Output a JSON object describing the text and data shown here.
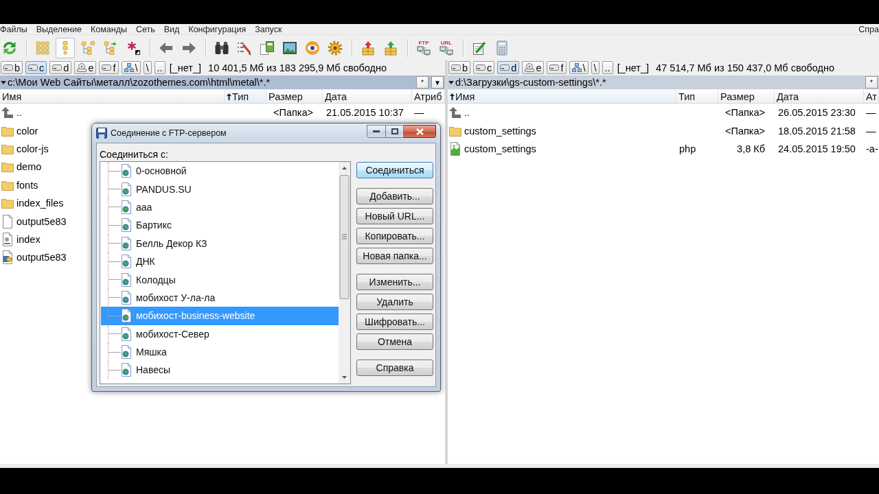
{
  "menu": {
    "items": [
      "Файлы",
      "Выделение",
      "Команды",
      "Сеть",
      "Вид",
      "Конфигурация",
      "Запуск"
    ],
    "help_item": "Спра"
  },
  "toolbar": [
    {
      "kind": "button",
      "selected": false
    },
    {
      "kind": "separator"
    },
    {
      "kind": "button",
      "selected": false
    },
    {
      "kind": "button",
      "selected": true
    },
    {
      "kind": "button",
      "selected": false
    },
    {
      "kind": "button",
      "selected": false
    },
    {
      "kind": "button",
      "selected": false
    },
    {
      "kind": "separator"
    },
    {
      "kind": "button",
      "selected": false
    },
    {
      "kind": "button",
      "selected": false
    },
    {
      "kind": "separator"
    },
    {
      "kind": "button",
      "selected": false
    },
    {
      "kind": "button",
      "selected": false
    },
    {
      "kind": "button",
      "selected": false
    },
    {
      "kind": "button",
      "selected": false
    },
    {
      "kind": "button",
      "selected": false
    },
    {
      "kind": "button",
      "selected": false
    },
    {
      "kind": "separator"
    },
    {
      "kind": "button",
      "selected": false
    },
    {
      "kind": "button",
      "selected": false
    },
    {
      "kind": "separator"
    },
    {
      "kind": "button",
      "selected": false,
      "label": "FTP"
    },
    {
      "kind": "button",
      "selected": false,
      "label": "URL"
    },
    {
      "kind": "separator"
    },
    {
      "kind": "button",
      "selected": false
    },
    {
      "kind": "button",
      "selected": false
    }
  ],
  "panels": [
    {
      "active": true,
      "drives": [
        {
          "label": "b",
          "kind": "disk",
          "selected": false
        },
        {
          "label": "c",
          "kind": "disk",
          "selected": true
        },
        {
          "label": "d",
          "kind": "disk",
          "selected": false
        },
        {
          "label": "e",
          "kind": "optical",
          "selected": false
        },
        {
          "label": "f",
          "kind": "disk",
          "selected": false
        }
      ],
      "nav_buttons": [
        {
          "kind": "network",
          "label": "\\"
        },
        {
          "kind": "plain",
          "label": "\\"
        },
        {
          "kind": "plain",
          "label": ".."
        }
      ],
      "volume_label": "[_нет_]",
      "free_space": "10 401,5 Мб из 183 295,9 Мб свободно",
      "path": "c:\\Мои Web Сайты\\металл\\zozothemes.com\\html\\metal\\*.*",
      "path_buttons": [
        "*",
        "▼"
      ],
      "columns": [
        {
          "label": "Имя",
          "sorted": false
        },
        {
          "label": "Тип",
          "sorted": true
        },
        {
          "label": "Размер",
          "sorted": false
        },
        {
          "label": "Дата",
          "sorted": false
        },
        {
          "label": "Атриб",
          "sorted": false
        }
      ],
      "rows": [
        {
          "kind": "parent",
          "name": "..",
          "size": "<Папка>",
          "date": "21.05.2015 10:37",
          "attributes": "—"
        },
        {
          "kind": "folder",
          "name": "color"
        },
        {
          "kind": "folder",
          "name": "color-js"
        },
        {
          "kind": "folder",
          "name": "demo"
        },
        {
          "kind": "folder",
          "name": "fonts"
        },
        {
          "kind": "folder",
          "name": "index_files"
        },
        {
          "kind": "file",
          "name": "output5e83"
        },
        {
          "kind": "html",
          "name": "index"
        },
        {
          "kind": "script",
          "name": "output5e83"
        }
      ]
    },
    {
      "active": false,
      "drives": [
        {
          "label": "b",
          "kind": "disk",
          "selected": false
        },
        {
          "label": "c",
          "kind": "disk",
          "selected": false
        },
        {
          "label": "d",
          "kind": "disk",
          "selected": true
        },
        {
          "label": "e",
          "kind": "optical",
          "selected": false
        },
        {
          "label": "f",
          "kind": "disk",
          "selected": false
        }
      ],
      "nav_buttons": [
        {
          "kind": "network",
          "label": "\\"
        },
        {
          "kind": "plain",
          "label": "\\"
        },
        {
          "kind": "plain",
          "label": ".."
        }
      ],
      "volume_label": "[_нет_]",
      "free_space": "47 514,7 Мб из 150 437,0 Мб свободно",
      "path": "d:\\Загрузки\\gs-custom-settings\\*.*",
      "path_buttons": [
        "*"
      ],
      "columns": [
        {
          "label": "Имя",
          "sorted": true
        },
        {
          "label": "Тип",
          "sorted": false
        },
        {
          "label": "Размер",
          "sorted": false
        },
        {
          "label": "Дата",
          "sorted": false
        },
        {
          "label": "Ат",
          "sorted": false
        }
      ],
      "rows": [
        {
          "kind": "parent",
          "name": "..",
          "size": "<Папка>",
          "date": "26.05.2015 23:30",
          "attributes": "—"
        },
        {
          "kind": "folder",
          "name": "custom_settings",
          "size": "<Папка>",
          "date": "18.05.2015 21:58",
          "attributes": "—"
        },
        {
          "kind": "php",
          "name": "custom_settings",
          "type": "php",
          "size": "3,8 Кб",
          "date": "24.05.2015 19:50",
          "attributes": "-a-"
        }
      ]
    }
  ],
  "dialog": {
    "title": "Соединение с FTP-сервером",
    "list_label": "Соединиться с:",
    "connections": [
      {
        "name": "0-основной",
        "selected": false
      },
      {
        "name": "PANDUS.SU",
        "selected": false
      },
      {
        "name": "aaa",
        "selected": false
      },
      {
        "name": "Бартикс",
        "selected": false
      },
      {
        "name": "Белль Декор КЗ",
        "selected": false
      },
      {
        "name": "ДНК",
        "selected": false
      },
      {
        "name": "Колодцы",
        "selected": false
      },
      {
        "name": "мобихост У-ла-ла",
        "selected": false
      },
      {
        "name": "мобихост-business-website",
        "selected": true
      },
      {
        "name": "мобихост-Север",
        "selected": false
      },
      {
        "name": "Мяшка",
        "selected": false
      },
      {
        "name": "Навесы",
        "selected": false
      }
    ],
    "button_groups": [
      [
        {
          "label": "Соединиться",
          "highlighted": true
        }
      ],
      [
        {
          "label": "Добавить...",
          "highlighted": false
        },
        {
          "label": "Новый URL...",
          "highlighted": false
        },
        {
          "label": "Копировать...",
          "highlighted": false
        },
        {
          "label": "Новая папка...",
          "highlighted": false
        }
      ],
      [
        {
          "label": "Изменить...",
          "highlighted": false
        },
        {
          "label": "Удалить",
          "highlighted": false
        },
        {
          "label": "Шифровать...",
          "highlighted": false
        },
        {
          "label": "Отмена",
          "highlighted": false
        }
      ],
      [
        {
          "label": "Справка",
          "highlighted": false
        }
      ]
    ]
  }
}
